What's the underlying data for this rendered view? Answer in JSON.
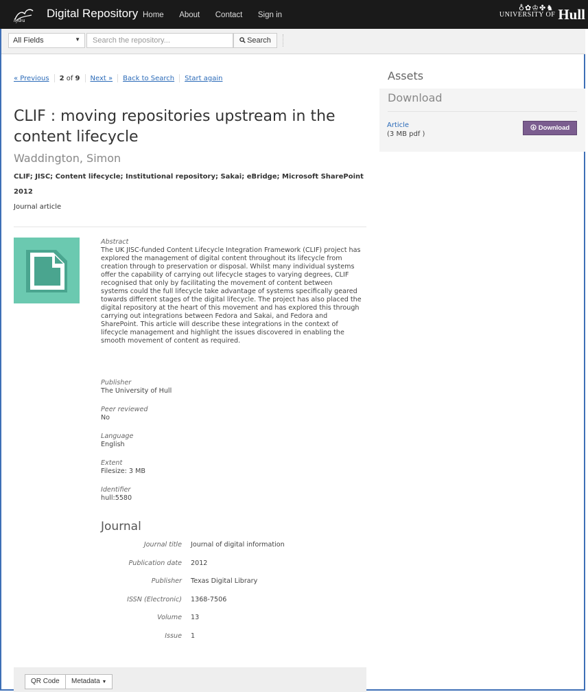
{
  "navbar": {
    "brand": "Digital Repository",
    "logo_text": "hydra",
    "links": [
      "Home",
      "About",
      "Contact",
      "Sign in"
    ],
    "university_small": "UNIVERSITY OF",
    "university_big": "Hull"
  },
  "search": {
    "field_value": "All Fields",
    "placeholder": "Search the repository...",
    "button_label": "Search"
  },
  "pager": {
    "previous": "« Previous",
    "current": "2",
    "of_label": "of",
    "total": "9",
    "next": "Next »",
    "back": "Back to Search",
    "start_again": "Start again"
  },
  "record": {
    "title": "CLIF : moving repositories upstream in the content lifecycle",
    "author": "Waddington, Simon",
    "subjects": "CLIF; JISC; Content lifecycle; Institutional repository; Sakai; eBridge; Microsoft SharePoint",
    "year": "2012",
    "type": "Journal article",
    "abstract_label": "Abstract",
    "abstract": "The UK JISC-funded Content Lifecycle Integration Framework (CLIF) project has explored the management of digital content throughout its lifecycle from creation through to preservation or disposal. Whilst many individual systems offer the capability of carrying out lifecycle stages to varying degrees, CLIF recognised that only by facilitating the movement of content between systems could the full lifecycle take advantage of systems specifically geared towards different stages of the digital lifecycle. The project has also placed the digital repository at the heart of this movement and has explored this through carrying out integrations between Fedora and Sakai, and Fedora and SharePoint. This article will describe these integrations in the context of lifecycle management and highlight the issues discovered in enabling the smooth movement of content as required.",
    "fields": [
      {
        "label": "Publisher",
        "value": "The University of Hull"
      },
      {
        "label": "Peer reviewed",
        "value": "No"
      },
      {
        "label": "Language",
        "value": "English"
      },
      {
        "label": "Extent",
        "value": "Filesize: 3 MB"
      },
      {
        "label": "Identifier",
        "value": "hull:5580"
      }
    ]
  },
  "journal": {
    "heading": "Journal",
    "rows": [
      {
        "label": "Journal title",
        "value": "Journal of digital information"
      },
      {
        "label": "Publication date",
        "value": "2012"
      },
      {
        "label": "Publisher",
        "value": "Texas Digital Library"
      },
      {
        "label": "ISSN (Electronic)",
        "value": "1368-7506"
      },
      {
        "label": "Volume",
        "value": "13"
      },
      {
        "label": "Issue",
        "value": "1"
      }
    ]
  },
  "footer": {
    "qr_label": "QR Code",
    "metadata_label": "Metadata"
  },
  "assets": {
    "heading": "Assets",
    "download_heading": "Download",
    "item_label": "Article",
    "item_size": "(3 MB pdf )",
    "download_button": "Download",
    "button_color": "#7b5d8f"
  },
  "colors": {
    "link": "#2a6ab8",
    "navbar": "#1a1a1a",
    "thumb": "#6bc9b0"
  }
}
